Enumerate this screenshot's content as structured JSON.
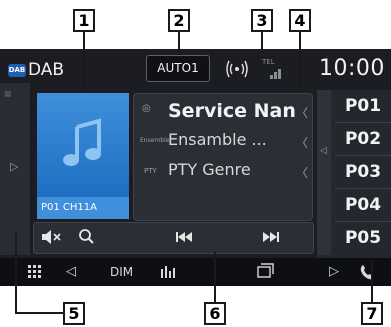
{
  "header": {
    "source_badge": "DAB",
    "source_label": "DAB",
    "clock": "10:00"
  },
  "top_controls": {
    "seek_mode_button": "AUTO1",
    "signal_small_text": "TEL"
  },
  "album": {
    "caption": "P01   CH11A"
  },
  "info": {
    "service_icon": "◎",
    "service_name": "Service Nan",
    "ensemble_icon": "Ensemble",
    "ensemble_name": "Ensamble ...",
    "pty_icon": "PTY",
    "pty_genre": "PTY Genre"
  },
  "presets": [
    "P01",
    "P02",
    "P03",
    "P04",
    "P05"
  ],
  "controls": {
    "mute_icon": "mute-icon",
    "search_icon": "search-icon",
    "prev_icon": "previous-icon",
    "next_icon": "next-icon"
  },
  "system_bar": {
    "dim_label": "DIM"
  },
  "callouts": [
    "1",
    "2",
    "3",
    "4",
    "5",
    "6",
    "7"
  ],
  "colors": {
    "screen_bg": "#1b1d22",
    "panel_bg": "#2a2e35",
    "art_blue": "#3f8fdc",
    "dab_badge": "#1d5fb0"
  }
}
